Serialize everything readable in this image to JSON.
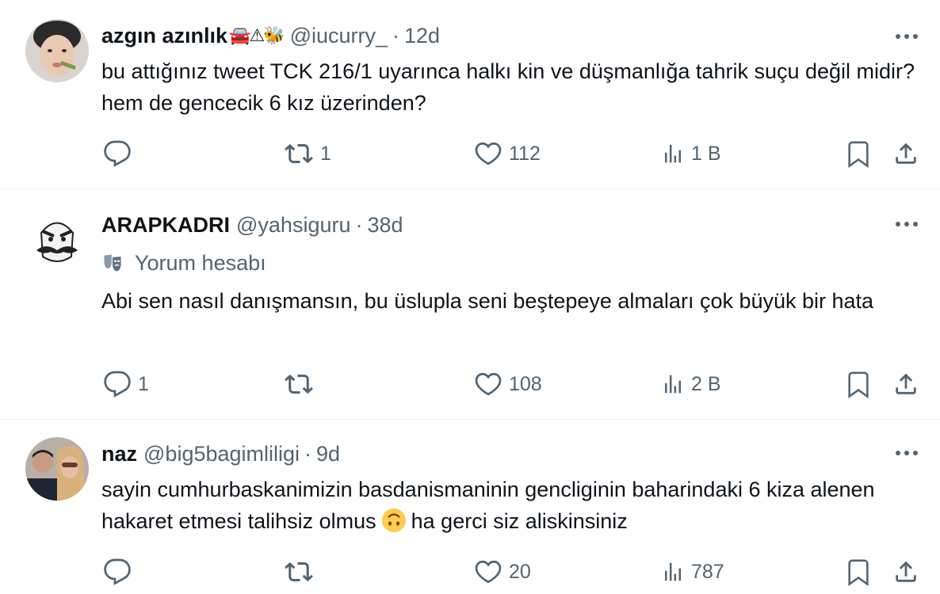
{
  "tweets": [
    {
      "name": "azgın azınlık",
      "name_suffix": "🚘⚠🐝",
      "handle": "@iucurry_",
      "separator": "·",
      "time": "12d",
      "badge": "",
      "text": "bu attığınız tweet TCK 216/1 uyarınca halkı kin ve düşmanlığa tahrik suçu değil midir? hem de gencecik 6 kız üzerinden?",
      "reply_count": "",
      "repost_count": "1",
      "like_count": "112",
      "view_count": "1 B"
    },
    {
      "name": "ARAPKADRI",
      "name_suffix": "",
      "handle": "@yahsiguru",
      "separator": "·",
      "time": "38d",
      "badge": "Yorum hesabı",
      "text": "Abi sen nasıl danışmansın, bu üslupla seni beştepeye almaları çok büyük bir hata",
      "reply_count": "1",
      "repost_count": "",
      "like_count": "108",
      "view_count": "2 B"
    },
    {
      "name": "naz",
      "name_suffix": "",
      "handle": "@big5bagimliligi",
      "separator": "·",
      "time": "9d",
      "badge": "",
      "text_part1": "sayin cumhurbaskanimizin basdanismaninin gencliginin baharindaki 6 kiza alenen hakaret etmesi talihsiz olmus",
      "text_part2": "ha gerci siz aliskinsiniz",
      "reply_count": "",
      "repost_count": "",
      "like_count": "20",
      "view_count": "787"
    }
  ],
  "colors": {
    "text_primary": "#0f1419",
    "text_secondary": "#536471",
    "divider": "#eff3f4"
  },
  "icons": {
    "reply": "reply-icon",
    "repost": "repost-icon",
    "like": "heart-icon",
    "views": "views-chart-icon",
    "bookmark": "bookmark-icon",
    "share": "share-icon",
    "more": "more-dots-icon",
    "badge": "theater-mask-icon"
  }
}
